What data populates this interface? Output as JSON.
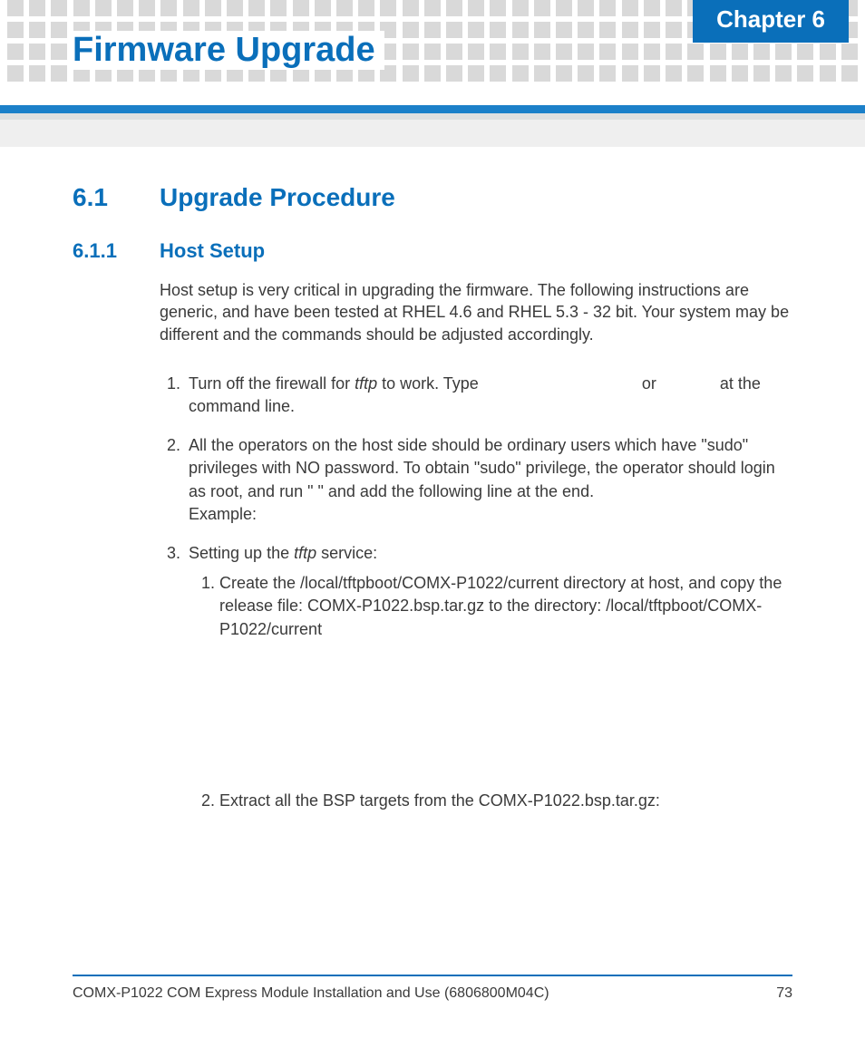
{
  "header": {
    "chapter_label": "Chapter 6",
    "title": "Firmware Upgrade"
  },
  "section": {
    "number": "6.1",
    "title": "Upgrade Procedure"
  },
  "subsection": {
    "number": "6.1.1",
    "title": "Host Setup"
  },
  "intro_paragraph": "Host setup is very critical in upgrading the firmware. The following instructions are generic, and have been tested at RHEL 4.6 and RHEL 5.3 - 32 bit. Your system may be different and the commands should be adjusted accordingly.",
  "steps": {
    "s1_a": "Turn off the firewall for ",
    "s1_i1": "tftp",
    "s1_b": " to work.  Type ",
    "s1_c": " or ",
    "s1_d": " at the command line.",
    "s2": "All the operators on the host side should be ordinary users which have \"sudo\" privileges with NO password. To obtain \"sudo\" privilege, the operator should login as root, and run \"                 \" and add the following line at the end.",
    "s2_example": "Example:",
    "s3_a": "Setting up the ",
    "s3_i": "tftp",
    "s3_b": " service:",
    "s3_1": "Create the /local/tftpboot/COMX-P1022/current directory at host, and copy the release file: COMX-P1022.bsp.tar.gz to the directory: /local/tftpboot/COMX-P1022/current",
    "s3_2": "Extract all the BSP targets from the COMX-P1022.bsp.tar.gz:"
  },
  "footer": {
    "doc_title": "COMX-P1022 COM Express Module Installation and Use (6806800M04C)",
    "page_number": "73"
  }
}
